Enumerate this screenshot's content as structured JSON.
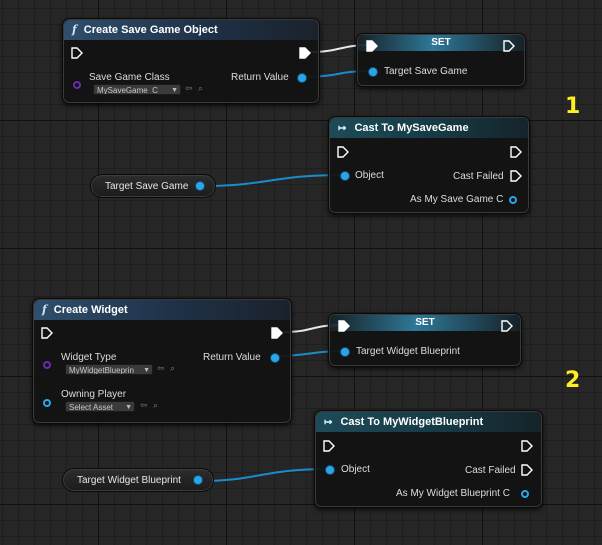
{
  "node_create_save": {
    "title": "Create Save Game Object",
    "param_label": "Save Game Class",
    "param_value": "MySaveGame_C",
    "return_label": "Return Value"
  },
  "node_set_1": {
    "title": "SET",
    "pin_label": "Target Save Game"
  },
  "node_cast_save": {
    "title": "Cast To MySaveGame",
    "object_label": "Object",
    "failed_label": "Cast Failed",
    "as_label": "As My Save Game C"
  },
  "var_1": {
    "label": "Target Save Game"
  },
  "marker_1": "1",
  "node_create_widget": {
    "title": "Create Widget",
    "type_label": "Widget Type",
    "type_value": "MyWidgetBlueprin",
    "owner_label": "Owning Player",
    "owner_value": "Select Asset",
    "return_label": "Return Value"
  },
  "node_set_2": {
    "title": "SET",
    "pin_label": "Target Widget Blueprint"
  },
  "node_cast_widget": {
    "title": "Cast To MyWidgetBlueprint",
    "object_label": "Object",
    "failed_label": "Cast Failed",
    "as_label": "As My Widget Blueprint C"
  },
  "var_2": {
    "label": "Target Widget Blueprint"
  },
  "marker_2": "2",
  "colors": {
    "exec": "#ffffff",
    "object_pin": "#2aa6e8",
    "class_pin": "#6a2bb0",
    "marker": "#ffee22"
  },
  "icons": {
    "function": "function-icon",
    "cast": "cast-icon"
  }
}
